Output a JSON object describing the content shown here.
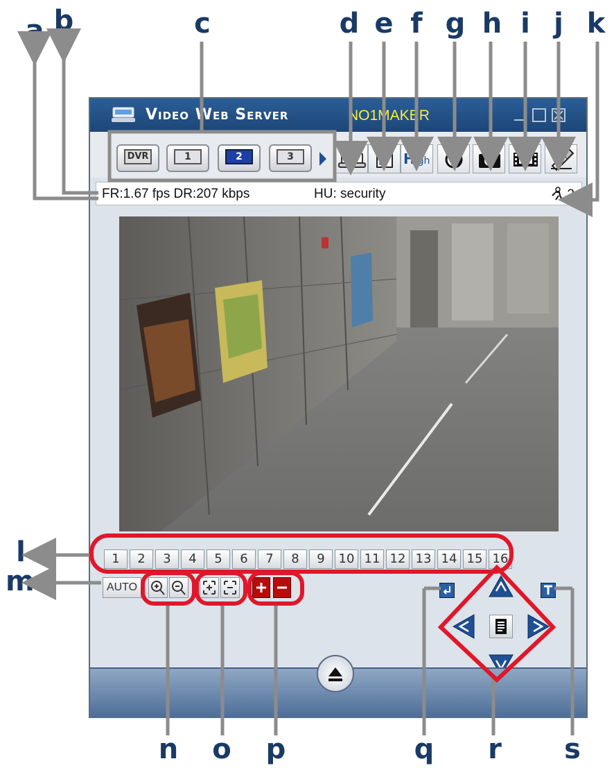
{
  "window": {
    "title": "Video Web Server",
    "subtitle": "NO1MAKER"
  },
  "toolbar": {
    "channel_buttons": [
      "DVR",
      "1",
      "2",
      "3"
    ],
    "active_channel": "2",
    "quality_label_main": "H",
    "quality_label_small": "igh"
  },
  "status": {
    "frame_rate": "FR:1.67 fps DR:207 kbps",
    "host_user": "HU: security",
    "online_users": "2"
  },
  "channels": [
    "1",
    "2",
    "3",
    "4",
    "5",
    "6",
    "7",
    "8",
    "9",
    "10",
    "11",
    "12",
    "13",
    "14",
    "15",
    "16"
  ],
  "controls": {
    "auto_label": "AUTO"
  },
  "callouts": {
    "top": [
      "a",
      "b",
      "c",
      "d",
      "e",
      "f",
      "g",
      "h",
      "i",
      "j",
      "k"
    ],
    "left": [
      "l",
      "m"
    ],
    "bottom": [
      "n",
      "o",
      "p",
      "q",
      "r",
      "s"
    ]
  },
  "colors": {
    "title_bar": "#1d4677",
    "subtitle_text": "#ffee3a",
    "callout_text": "#1a3a66",
    "highlight_red": "#e0172a",
    "leader_line": "#8c8c8c",
    "ptz_blue": "#1f4f95"
  },
  "icons": [
    "monitor-icon",
    "fullscreen-icon",
    "contrast-icon",
    "camera-icon",
    "film-icon",
    "settings-icon",
    "user-icon",
    "zoom-in-icon",
    "zoom-out-icon",
    "focus-near-icon",
    "focus-far-icon",
    "iris-plus-icon",
    "iris-minus-icon",
    "enter-icon",
    "ptz-up-icon",
    "ptz-down-icon",
    "ptz-left-icon",
    "ptz-right-icon",
    "ptz-menu-icon",
    "t-icon",
    "eject-icon"
  ]
}
